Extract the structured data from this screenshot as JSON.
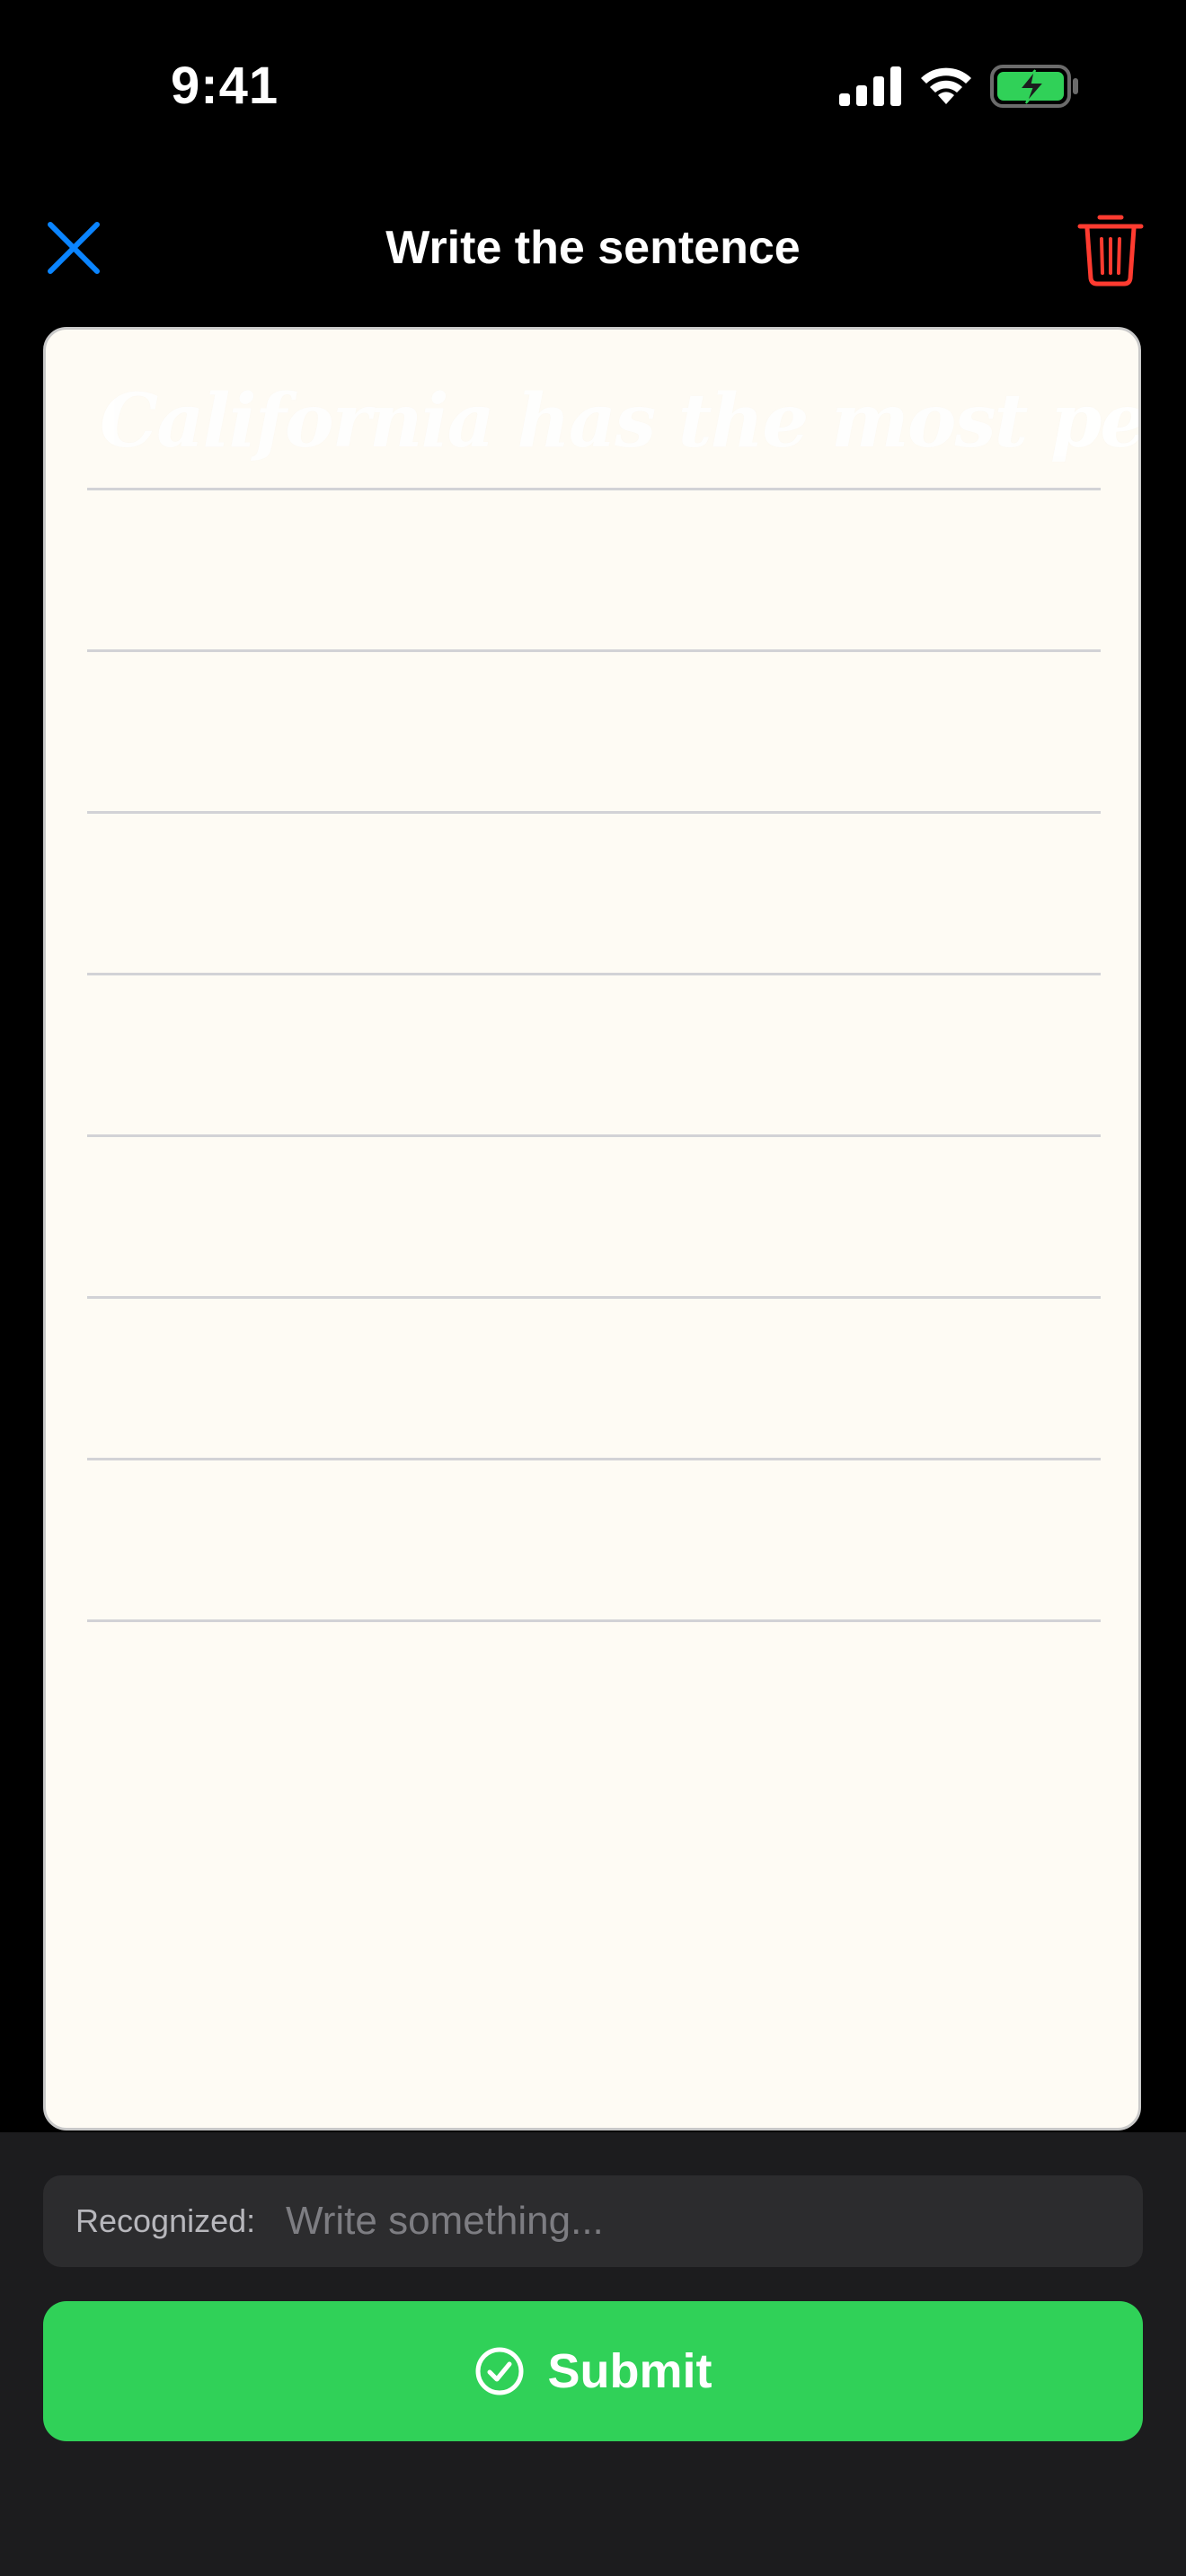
{
  "status_bar": {
    "time": "9:41",
    "signal_icon": "cellular-signal-icon",
    "wifi_icon": "wifi-icon",
    "battery_icon": "battery-charging-icon",
    "battery_color": "#30d158"
  },
  "nav": {
    "title": "Write the sentence",
    "close_icon": "close-icon",
    "close_color": "#0a84ff",
    "trash_icon": "trash-icon",
    "trash_color": "#ff3b30"
  },
  "canvas": {
    "ghost_sentence": "California has the most people.",
    "ruled_lines": 8,
    "background": "#fefbf4"
  },
  "recognized": {
    "label": "Recognized:",
    "placeholder": "Write something..."
  },
  "submit": {
    "label": "Submit",
    "icon": "checkmark-circle-icon",
    "color": "#30d158"
  }
}
